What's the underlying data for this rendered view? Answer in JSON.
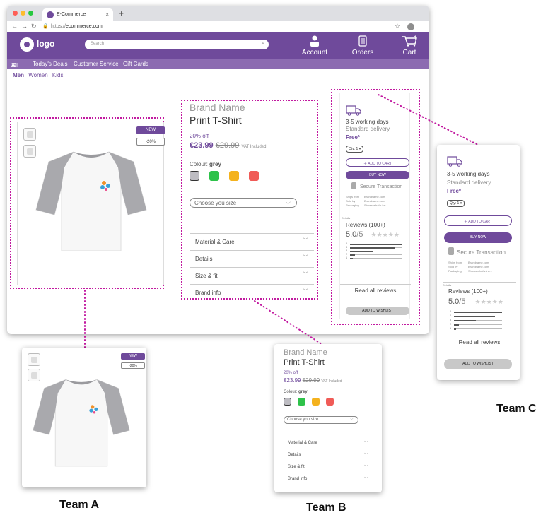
{
  "browser": {
    "tab_title": "E-Commerce",
    "tab_close": "×",
    "new_tab": "+",
    "url_prefix": "https://",
    "url_host": "ecommerce.com"
  },
  "header": {
    "logo_text": "logo",
    "search_placeholder": "Search",
    "account_label": "Account",
    "orders_label": "Orders",
    "cart_label": "Cart",
    "cart_count": "1"
  },
  "subnav": {
    "all_label": "All",
    "items": [
      "Today's Deals",
      "Customer Service",
      "Gift Cards"
    ]
  },
  "categories": [
    "Men",
    "Women",
    "Kids"
  ],
  "product_image": {
    "badge_new": "NEW",
    "badge_discount": "-20%"
  },
  "product_info": {
    "brand": "Brand Name",
    "title": "Print T-Shirt",
    "discount": "20% off",
    "price": "€23.99",
    "old_price": "€29.99",
    "vat": "VAT Included",
    "colour_label": "Colour:",
    "colour_value": "grey",
    "swatches": [
      "#bdbcc2",
      "#2ec24a",
      "#f4b21e",
      "#f05b57"
    ],
    "size_placeholder": "Choose you size",
    "accordion": [
      "Material & Care",
      "Details",
      "Size & fit",
      "Brand info"
    ]
  },
  "delivery": {
    "days": "3-5 working days",
    "type": "Standard delivery",
    "free": "Free*",
    "qty": "Qty: 1",
    "add_to_cart": "ADD TO CART",
    "buy_now": "BUY NOW",
    "secure": "Secure Transaction",
    "meta_labels": [
      "Ships from",
      "Sold by",
      "Packaging"
    ],
    "meta_values": [
      "Brandname.com",
      "Brandname.com",
      "Shows what's ins..."
    ],
    "details": "Details",
    "reviews_title": "Reviews (100+)",
    "rating": "5.0",
    "rating_max": "/5",
    "stars": "★★★★★",
    "bars": [
      {
        "label": "5",
        "fill": 1.0
      },
      {
        "label": "4",
        "fill": 0.85
      },
      {
        "label": "3",
        "fill": 0.45
      },
      {
        "label": "2",
        "fill": 0.1
      },
      {
        "label": "1",
        "fill": 0.05
      }
    ],
    "read_all": "Read all reviews",
    "wishlist": "ADD TO WISHLIST"
  },
  "teams": {
    "a": "Team A",
    "b": "Team B",
    "c": "Team C"
  }
}
